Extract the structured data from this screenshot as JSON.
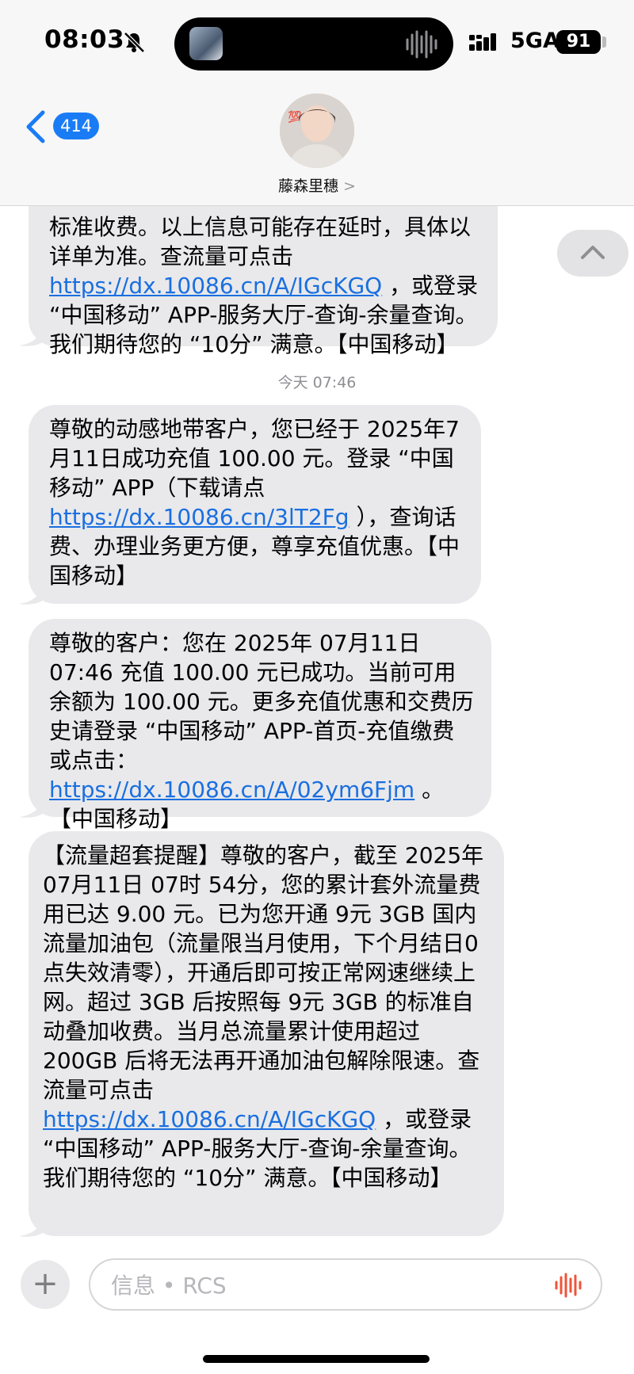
{
  "status_bar": {
    "time": "08:03",
    "network": "5GA",
    "battery": "91"
  },
  "nav": {
    "back_count": "414",
    "contact_name": "藤森里穗",
    "contact_chevron": ">"
  },
  "messages": [
    {
      "segments": [
        {
          "t": "标准收费。以上信息可能存在延时，具体以详单为准。查流量可点击 "
        },
        {
          "t": "https://dx.10086.cn/A/IGcKGQ",
          "link": true
        },
        {
          "t": " ，或登录 “中国移动” APP-服务大厅-查询-余量查询。我们期待您的 “10分” 满意。【中国移动】"
        }
      ]
    },
    {
      "segments": [
        {
          "t": "尊敬的动感地带客户，您已经于 2025年7月11日成功充值 100.00 元。登录 “中国移动” APP（下载请点 "
        },
        {
          "t": "https://dx.10086.cn/3lT2Fg",
          "link": true
        },
        {
          "t": " ），查询话费、办理业务更方便，尊享充值优惠。【中国移动】"
        }
      ]
    },
    {
      "segments": [
        {
          "t": "尊敬的客户：您在 2025年 07月11日 07:46 充值 100.00 元已成功。当前可用余额为 100.00 元。更多充值优惠和交费历史请登录 “中国移动” APP-首页-充值缴费或点击："
        },
        {
          "t": "https://dx.10086.cn/A/02ym6Fjm",
          "link": true
        },
        {
          "t": " 。【中国移动】"
        }
      ]
    },
    {
      "segments": [
        {
          "t": "【流量超套提醒】尊敬的客户，截至 2025年 07月11日 07时 54分，您的累计套外流量费用已达 9.00 元。已为您开通 9元 3GB 国内流量加油包（流量限当月使用，下个月结日0点失效清零），开通后即可按正常网速继续上网。超过 3GB 后按照每 9元 3GB 的标准自动叠加收费。当月总流量累计使用超过 200GB 后将无法再开通加油包解除限速。查流量可点击 "
        },
        {
          "t": "https://dx.10086.cn/A/IGcKGQ",
          "link": true
        },
        {
          "t": " ，或登录 “中国移动” APP-服务大厅-查询-余量查询。我们期待您的 “10分” 满意。【中国移动】"
        }
      ]
    }
  ],
  "timestamp": "今天 07:46",
  "composer": {
    "placeholder": "信息 • RCS"
  },
  "colors": {
    "bubble_bg": "#e9e9eb",
    "link": "#1a6fe0",
    "accent": "#1a7cf5"
  },
  "icons": [
    "bell-slash-icon",
    "signal-icon",
    "chevron-left-icon",
    "chevron-up-icon",
    "plus-icon",
    "waveform-icon"
  ]
}
